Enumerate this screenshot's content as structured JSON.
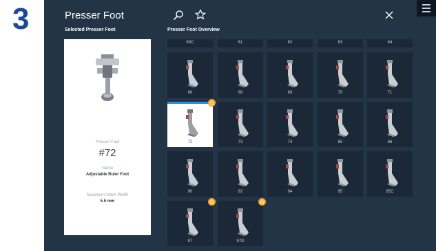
{
  "step_number": "3",
  "app": {
    "title": "Presser Foot",
    "selected_label": "Selected Presser Foot",
    "overview_label": "Presser Foot Overview"
  },
  "icons": {
    "search": "search-icon",
    "favorites": "star-icon",
    "close": "close-icon",
    "menu": "menu-icon"
  },
  "selected": {
    "caption": "Presser Foot",
    "number": "#72",
    "name_caption": "Name",
    "name": "Adjustable Ruler Foot",
    "width_caption": "Maximum Stitch Width",
    "width": "5.5 mm"
  },
  "top_row": [
    "60C",
    "61",
    "62",
    "63",
    "64"
  ],
  "feet": [
    {
      "label": "66",
      "favorite": false,
      "selected": false
    },
    {
      "label": "68",
      "favorite": false,
      "selected": false
    },
    {
      "label": "69",
      "favorite": false,
      "selected": false
    },
    {
      "label": "70",
      "favorite": false,
      "selected": false
    },
    {
      "label": "71",
      "favorite": false,
      "selected": false
    },
    {
      "label": "72",
      "favorite": true,
      "selected": true
    },
    {
      "label": "73",
      "favorite": false,
      "selected": false
    },
    {
      "label": "74",
      "favorite": false,
      "selected": false
    },
    {
      "label": "85",
      "favorite": false,
      "selected": false
    },
    {
      "label": "86",
      "favorite": false,
      "selected": false
    },
    {
      "label": "90",
      "favorite": false,
      "selected": false
    },
    {
      "label": "92",
      "favorite": false,
      "selected": false
    },
    {
      "label": "94",
      "favorite": false,
      "selected": false
    },
    {
      "label": "95",
      "favorite": false,
      "selected": false
    },
    {
      "label": "95C",
      "favorite": false,
      "selected": false
    },
    {
      "label": "97",
      "favorite": true,
      "selected": false
    },
    {
      "label": "97D",
      "favorite": true,
      "selected": false
    }
  ],
  "colors": {
    "accent": "#2e8fe6",
    "favorite": "#f5a623",
    "background": "#243447",
    "tile": "#1b2837",
    "step_number": "#1a4a93"
  }
}
